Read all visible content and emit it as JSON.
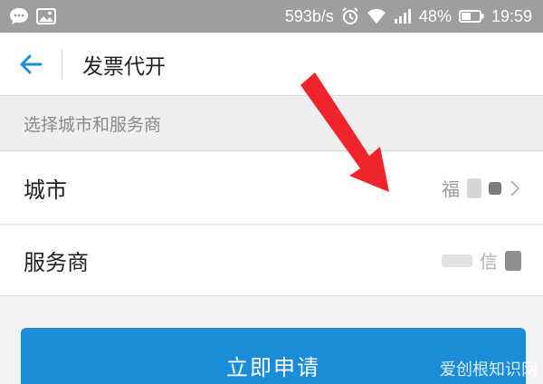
{
  "status_bar": {
    "left_icons": [
      "chat-bubble-icon",
      "image-icon"
    ],
    "net_speed": "593b/s",
    "battery_percent": "48%",
    "time": "19:59",
    "right_icons": [
      "alarm-icon",
      "wifi-icon",
      "signal-icon",
      "battery-icon"
    ]
  },
  "nav": {
    "back_icon": "back-arrow-icon",
    "title": "发票代开"
  },
  "section": {
    "header": "选择城市和服务商"
  },
  "form": {
    "city_label": "城市",
    "city_value_partial": "福",
    "provider_label": "服务商",
    "provider_value_partial": "信"
  },
  "actions": {
    "apply_label": "立即申请"
  },
  "annotation": {
    "arrow_color": "#f0242b"
  },
  "watermark": {
    "text": "爱创根知识网"
  },
  "colors": {
    "primary": "#1a8cd8",
    "status_bar": "#9e9e9e"
  }
}
